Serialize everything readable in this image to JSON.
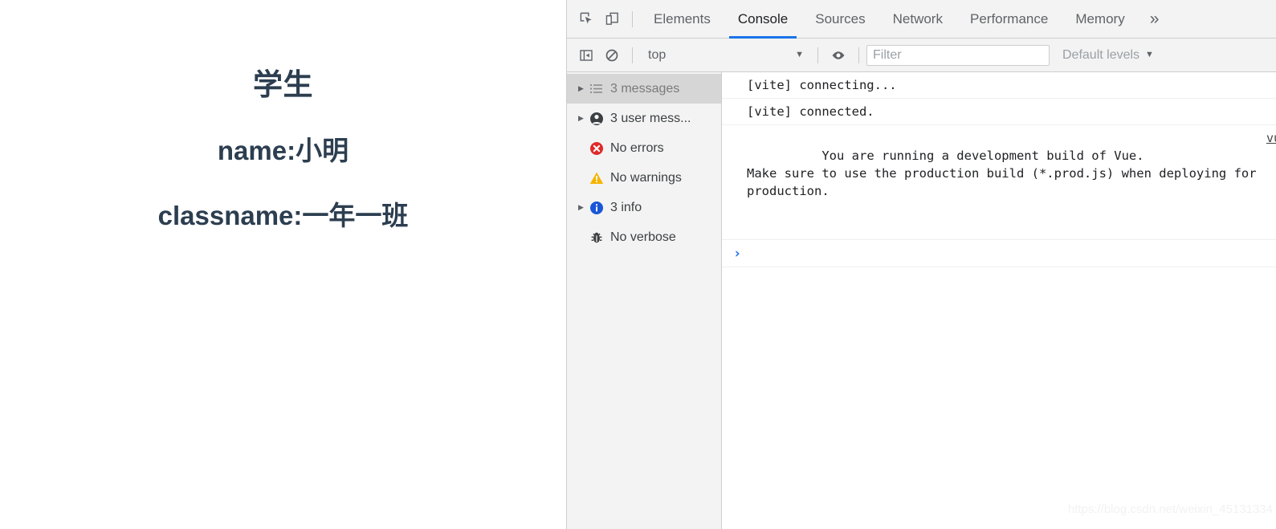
{
  "page": {
    "title": "学生",
    "name_line": "name:小明",
    "class_line": "classname:一年一班",
    "text_color": "#2c3e50"
  },
  "devtools": {
    "tabbar": {
      "inspect_icon": "inspect-element-icon",
      "device_icon": "device-toolbar-icon",
      "tabs": [
        {
          "label": "Elements",
          "active": false
        },
        {
          "label": "Console",
          "active": true
        },
        {
          "label": "Sources",
          "active": false
        },
        {
          "label": "Network",
          "active": false
        },
        {
          "label": "Performance",
          "active": false
        },
        {
          "label": "Memory",
          "active": false
        }
      ],
      "overflow_label": "»",
      "active_underline_color": "#1a73e8"
    },
    "console_toolbar": {
      "sidebar_toggle_icon": "show-console-sidebar-icon",
      "clear_icon": "clear-console-icon",
      "context_value": "top",
      "context_caret": "▼",
      "live_expression_icon": "eye-icon",
      "filter_placeholder": "Filter",
      "filter_value": "",
      "levels_label": "Default levels",
      "levels_caret": "▼"
    },
    "sidebar": {
      "items": [
        {
          "label": "3 messages",
          "icon": "list-icon",
          "arrow": "▶",
          "selected": true,
          "has_arrow": true
        },
        {
          "label": "3 user mess...",
          "icon": "person-icon",
          "arrow": "▶",
          "selected": false,
          "has_arrow": true
        },
        {
          "label": "No errors",
          "icon": "error-icon",
          "arrow": "",
          "selected": false,
          "has_arrow": false
        },
        {
          "label": "No warnings",
          "icon": "warning-icon",
          "arrow": "",
          "selected": false,
          "has_arrow": false
        },
        {
          "label": "3 info",
          "icon": "info-icon",
          "arrow": "▶",
          "selected": false,
          "has_arrow": true
        },
        {
          "label": "No verbose",
          "icon": "bug-icon",
          "arrow": "",
          "selected": false,
          "has_arrow": false
        }
      ],
      "colors": {
        "error": "#e02a2a",
        "warning": "#f5b400",
        "info": "#1a56d6",
        "selected_bg": "#d6d6d6"
      }
    },
    "messages": [
      {
        "text": "[vite] connecting...",
        "source": ""
      },
      {
        "text": "[vite] connected.",
        "source": ""
      },
      {
        "text": "You are running a development build of Vue.\nMake sure to use the production build (*.prod.js) when deploying for\nproduction.",
        "source": "vu"
      }
    ],
    "prompt_caret": "›"
  },
  "watermark": "https://blog.csdn.net/weixin_45131334"
}
